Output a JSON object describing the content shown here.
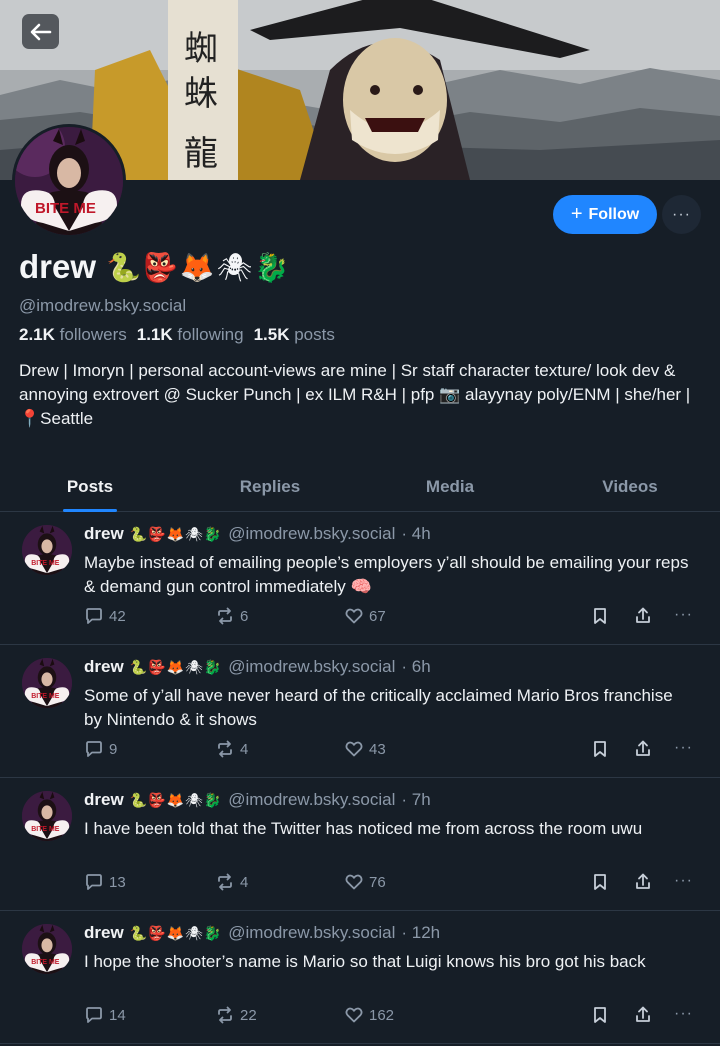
{
  "profile": {
    "display_name": "drew",
    "name_emojis": "🐍👺🦊🕷🐉",
    "handle": "@imodrew.bsky.social",
    "stats": {
      "followers_count": "2.1K",
      "followers_label": "followers",
      "following_count": "1.1K",
      "following_label": "following",
      "posts_count": "1.5K",
      "posts_label": "posts"
    },
    "bio": "Drew | Imoryn | personal account-views are mine | Sr staff character texture/ look dev & annoying extrovert @ Sucker Punch | ex ILM R&H | pfp 📷 alayynay poly/ENM | she/her |📍Seattle",
    "avatar_text": "BITE ME"
  },
  "header": {
    "back_icon": "arrow-left-icon",
    "follow_label": "Follow",
    "follow_icon": "plus-icon",
    "more_label": "···"
  },
  "tabs": [
    {
      "label": "Posts",
      "active": true
    },
    {
      "label": "Replies",
      "active": false
    },
    {
      "label": "Media",
      "active": false
    },
    {
      "label": "Videos",
      "active": false
    }
  ],
  "posts": [
    {
      "name": "drew",
      "emojis": "🐍👺🦊🕷🐉",
      "handle": "@imodrew.bsky.social",
      "time": "· 4h",
      "text": "Maybe instead of emailing people’s employers y’all should be emailing your reps & demand gun control immediately 🧠",
      "replies": "42",
      "reposts": "6",
      "likes": "67"
    },
    {
      "name": "drew",
      "emojis": "🐍👺🦊🕷🐉",
      "handle": "@imodrew.bsky.social",
      "time": "· 6h",
      "text": "Some of y’all have never heard of the critically acclaimed Mario Bros franchise by Nintendo & it shows",
      "replies": "9",
      "reposts": "4",
      "likes": "43"
    },
    {
      "name": "drew",
      "emojis": "🐍👺🦊🕷🐉",
      "handle": "@imodrew.bsky.social",
      "time": "· 7h",
      "text": "I have been told that the Twitter has noticed me from across the room uwu",
      "replies": "13",
      "reposts": "4",
      "likes": "76"
    },
    {
      "name": "drew",
      "emojis": "🐍👺🦊🕷🐉",
      "handle": "@imodrew.bsky.social",
      "time": "· 12h",
      "text": "I hope the shooter’s name is Mario so that Luigi knows his bro got his back",
      "replies": "14",
      "reposts": "22",
      "likes": "162"
    }
  ],
  "colors": {
    "background": "#161e27",
    "accent": "#2086ff",
    "muted_text": "#8b98a8",
    "divider": "#2c3744"
  }
}
